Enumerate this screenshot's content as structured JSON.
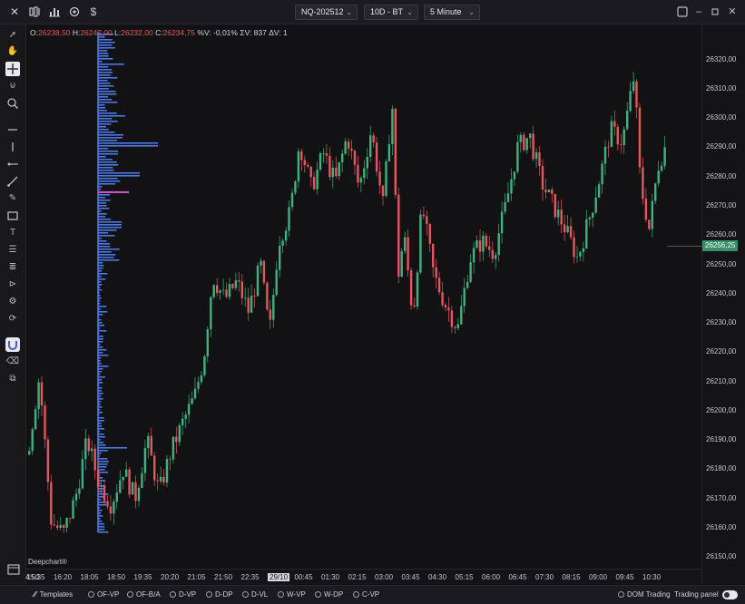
{
  "topbar": {
    "symbol": "NQ-202512",
    "period": "10D - BT",
    "timeframe": "5 Minute",
    "icons": [
      "close-icon",
      "layout-icon",
      "bar-chart-icon",
      "settings-icon",
      "dollar-icon",
      "maximize-icon",
      "minimize-icon",
      "restore-icon",
      "close-window-icon"
    ]
  },
  "ohlc": {
    "o_label": "O:",
    "o": "26238,50",
    "h_label": "H:",
    "h": "26242,00",
    "l_label": "L:",
    "l": "26232,00",
    "c_label": "C:",
    "c": "26234,75",
    "pct": "%V: -0,01%",
    "sum_v": "ΣV: 837",
    "delta_v": "ΔV: 1"
  },
  "price_tag": "26256,25",
  "watermark": "Deepchart®",
  "colors": {
    "up": "#3fb37f",
    "down": "#e5575d",
    "profile": "#4f7ff0",
    "poc": "#e04fd0",
    "background": "#121214"
  },
  "bottom": {
    "templates": "Templates",
    "options": [
      "OF-VP",
      "OF-B/A",
      "D-VP",
      "D-DP",
      "D-VL",
      "W-VP",
      "W-DP",
      "C-VP"
    ],
    "dom_trading": "DOM Trading",
    "trading_panel": "Trading panel"
  },
  "toolbar": [
    "pointer-icon",
    "hand-icon",
    "crosshair-icon",
    "magnet-icon",
    "zoom-icon",
    "horizontal-line-icon",
    "vertical-line-icon",
    "ray-icon",
    "trend-line-icon",
    "pencil-icon",
    "rectangle-icon",
    "text-icon",
    "fib-icon",
    "channel-icon",
    "marker-icon",
    "settings-list-icon",
    "alert-icon",
    "magnet-active-icon",
    "eraser-icon",
    "layers-icon"
  ],
  "chart_data": {
    "type": "candlestick",
    "y_ticks": [
      "26320,00",
      "26310,00",
      "26300,00",
      "26290,00",
      "26280,00",
      "26270,00",
      "26260,00",
      "26250,00",
      "26240,00",
      "26230,00",
      "26220,00",
      "26210,00",
      "26200,00",
      "26190,00",
      "26180,00",
      "26170,00",
      "26160,00",
      "26150,00"
    ],
    "ylim": [
      26146,
      26332
    ],
    "x_ticks": [
      "4:50",
      "15:35",
      "16:20",
      "18:05",
      "18:50",
      "19:35",
      "20:20",
      "21:05",
      "21:50",
      "22:35",
      "29/10",
      "00:45",
      "01:30",
      "02:15",
      "03:00",
      "03:45",
      "04:30",
      "05:15",
      "06:00",
      "06:45",
      "07:30",
      "08:15",
      "09:00",
      "09:45",
      "10:30"
    ],
    "path": [
      [
        0,
        26185
      ],
      [
        8,
        26212
      ],
      [
        16,
        26162
      ],
      [
        24,
        26158
      ],
      [
        32,
        26170
      ],
      [
        40,
        26190
      ],
      [
        48,
        26175
      ],
      [
        56,
        26168
      ],
      [
        64,
        26180
      ],
      [
        72,
        26170
      ],
      [
        80,
        26190
      ],
      [
        88,
        26172
      ],
      [
        96,
        26186
      ],
      [
        104,
        26196
      ],
      [
        112,
        26205
      ],
      [
        118,
        26218
      ],
      [
        124,
        26246
      ],
      [
        132,
        26238
      ],
      [
        140,
        26244
      ],
      [
        148,
        26234
      ],
      [
        156,
        26250
      ],
      [
        162,
        26226
      ],
      [
        168,
        26258
      ],
      [
        176,
        26268
      ],
      [
        182,
        26292
      ],
      [
        190,
        26276
      ],
      [
        198,
        26288
      ],
      [
        206,
        26278
      ],
      [
        214,
        26294
      ],
      [
        222,
        26276
      ],
      [
        230,
        26296
      ],
      [
        238,
        26270
      ],
      [
        244,
        26306
      ],
      [
        248,
        26246
      ],
      [
        252,
        26260
      ],
      [
        258,
        26232
      ],
      [
        264,
        26270
      ],
      [
        272,
        26246
      ],
      [
        280,
        26236
      ],
      [
        288,
        26228
      ],
      [
        296,
        26252
      ],
      [
        304,
        26258
      ],
      [
        312,
        26254
      ],
      [
        320,
        26270
      ],
      [
        328,
        26290
      ],
      [
        336,
        26294
      ],
      [
        344,
        26278
      ],
      [
        352,
        26270
      ],
      [
        360,
        26262
      ],
      [
        368,
        26252
      ],
      [
        376,
        26266
      ],
      [
        384,
        26282
      ],
      [
        390,
        26296
      ],
      [
        398,
        26292
      ],
      [
        406,
        26315
      ],
      [
        410,
        26278
      ],
      [
        416,
        26262
      ],
      [
        422,
        26284
      ],
      [
        428,
        26292
      ]
    ],
    "last_price": 26256.25,
    "poc_price": 26275
  }
}
